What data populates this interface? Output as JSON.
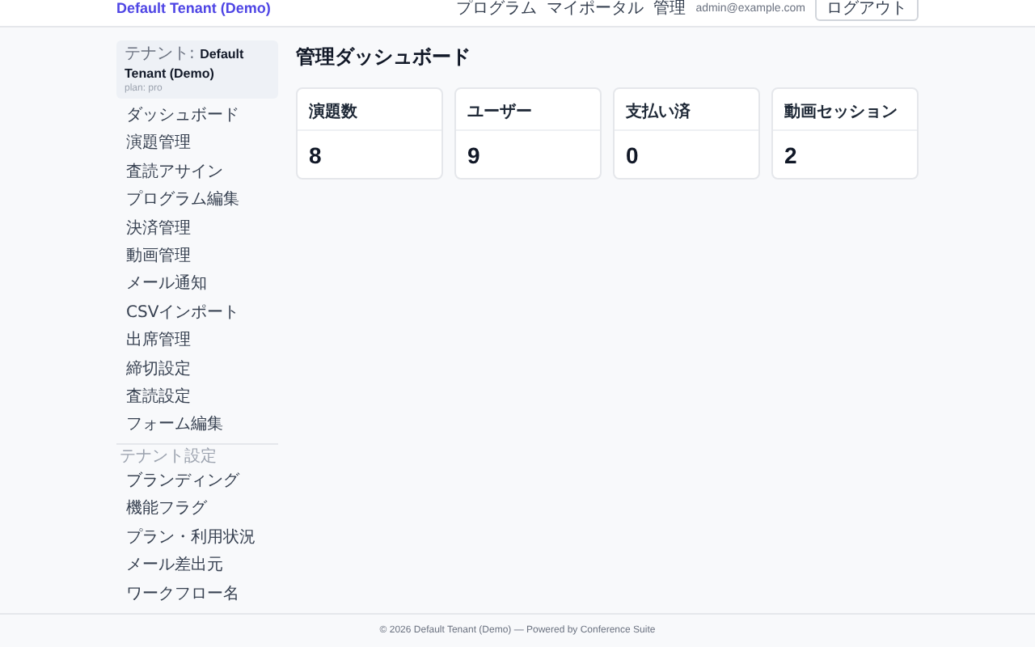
{
  "header": {
    "brand": "Default Tenant (Demo)",
    "nav": [
      "プログラム",
      "マイポータル",
      "管理"
    ],
    "user_email": "admin@example.com",
    "logout_button": "ログアウト"
  },
  "sidebar": {
    "tenant_label": "テナント: **Default Tenant (Demo)**",
    "plan": "plan: pro",
    "items": [
      {
        "label": "ダッシュボード"
      },
      {
        "label": "演題管理"
      },
      {
        "label": "査読アサイン"
      },
      {
        "label": "プログラム編集"
      },
      {
        "label": "決済管理"
      },
      {
        "label": "動画管理"
      },
      {
        "label": "メール通知"
      },
      {
        "label": "CSVインポート"
      },
      {
        "label": "出席管理"
      },
      {
        "label": "締切設定"
      },
      {
        "label": "査読設定"
      },
      {
        "label": "フォーム編集"
      }
    ],
    "section_title": "テナント設定",
    "section_items": [
      {
        "label": "ブランディング"
      },
      {
        "label": "機能フラグ"
      },
      {
        "label": "プラン・利用状況"
      },
      {
        "label": "メール差出元"
      },
      {
        "label": "ワークフロー名"
      }
    ]
  },
  "main": {
    "title": "管理ダッシュボード",
    "cards": [
      {
        "label": "演題数",
        "value": "8"
      },
      {
        "label": "ユーザー",
        "value": "9"
      },
      {
        "label": "支払い済",
        "value": "0"
      },
      {
        "label": "動画セッション",
        "value": "2"
      }
    ]
  },
  "footer": "© 2026 Default Tenant (Demo) — Powered by Conference Suite"
}
